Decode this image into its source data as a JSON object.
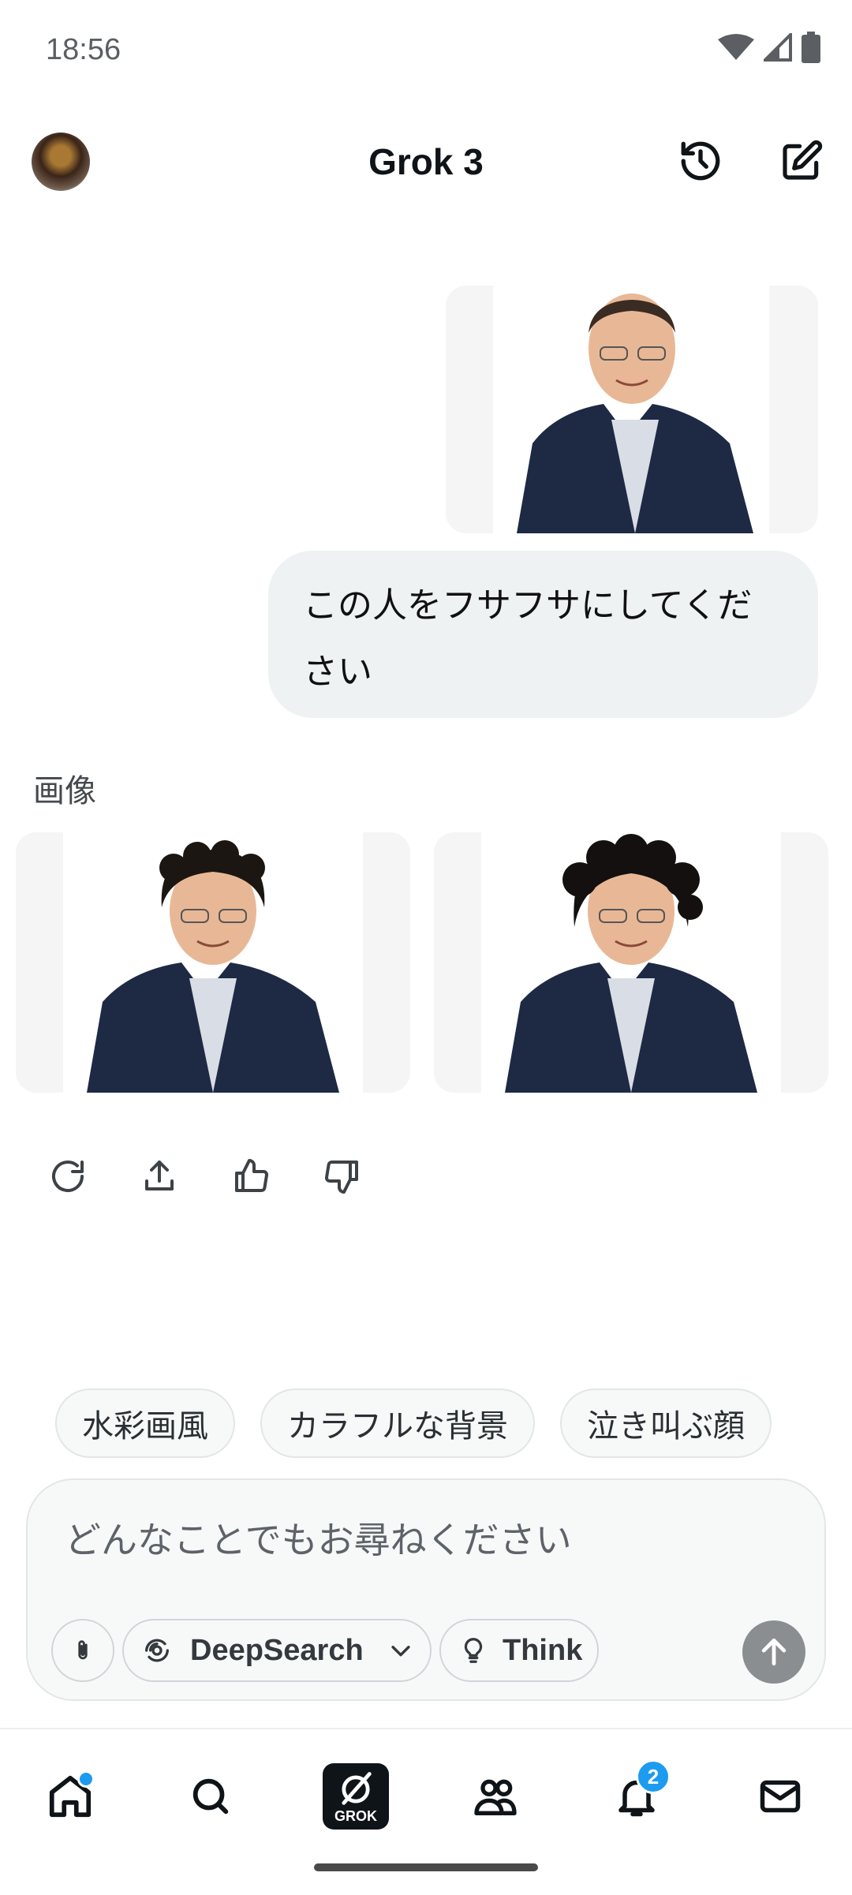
{
  "status": {
    "time": "18:56"
  },
  "header": {
    "title": "Grok 3"
  },
  "chat": {
    "user_message": "この人をフサフサにしてください",
    "response_section_label": "画像"
  },
  "suggestions": [
    "水彩画風",
    "カラフルな背景",
    "泣き叫ぶ顔"
  ],
  "composer": {
    "placeholder": "どんなことでもお尋ねください",
    "deepsearch_label": "DeepSearch",
    "think_label": "Think"
  },
  "nav": {
    "grok_label": "GROK",
    "notifications_count": "2"
  },
  "colors": {
    "accent": "#1d9bf0",
    "bubble": "#eff2f3"
  }
}
